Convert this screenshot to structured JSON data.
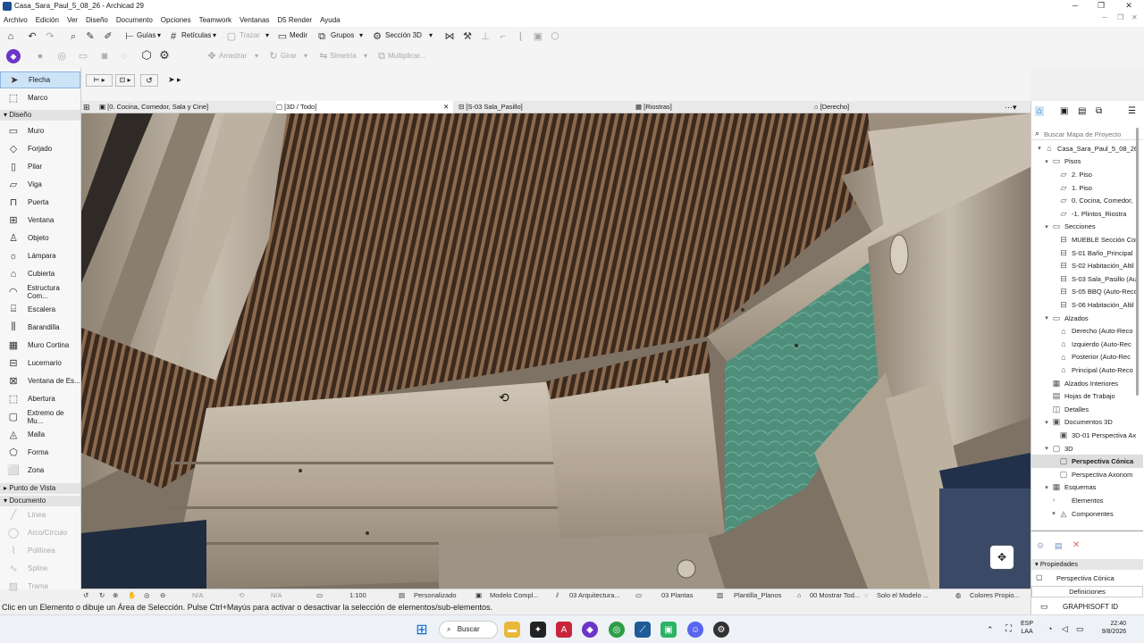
{
  "window": {
    "title": "Casa_Sara_Paul_5_08_26 - Archicad 29",
    "minimize": "─",
    "maximize": "❐",
    "close": "✕"
  },
  "menubar": [
    "Archivo",
    "Edición",
    "Ver",
    "Diseño",
    "Documento",
    "Opciones",
    "Teamwork",
    "Ventanas",
    "D5 Render",
    "Ayuda"
  ],
  "toolbar1": {
    "guias": "Guías",
    "reticulas": "Retículas",
    "trazar": "Trazar",
    "medir": "Medir",
    "grupos": "Grupos",
    "seccion3d": "Sección 3D"
  },
  "toolbar2": {
    "arrastrar": "Arrastrar",
    "girar": "Girar",
    "simetria": "Simetría",
    "multiplicar": "Multiplicar..."
  },
  "toolbox": {
    "select": [
      {
        "label": "Flecha",
        "icon": "arrow-icon"
      },
      {
        "label": "Marco",
        "icon": "marquee-icon"
      }
    ],
    "diseno_header": "Diseño",
    "diseno": [
      {
        "label": "Muro",
        "icon": "wall-icon"
      },
      {
        "label": "Forjado",
        "icon": "slab-icon"
      },
      {
        "label": "Pilar",
        "icon": "column-icon"
      },
      {
        "label": "Viga",
        "icon": "beam-icon"
      },
      {
        "label": "Puerta",
        "icon": "door-icon"
      },
      {
        "label": "Ventana",
        "icon": "window-icon"
      },
      {
        "label": "Objeto",
        "icon": "object-icon"
      },
      {
        "label": "Lámpara",
        "icon": "lamp-icon"
      },
      {
        "label": "Cubierta",
        "icon": "roof-icon"
      },
      {
        "label": "Estructura Com...",
        "icon": "shell-icon"
      },
      {
        "label": "Escalera",
        "icon": "stair-icon"
      },
      {
        "label": "Barandilla",
        "icon": "railing-icon"
      },
      {
        "label": "Muro Cortina",
        "icon": "curtain-wall-icon"
      },
      {
        "label": "Lucernario",
        "icon": "skylight-icon"
      },
      {
        "label": "Ventana de Es...",
        "icon": "corner-window-icon"
      },
      {
        "label": "Abertura",
        "icon": "opening-icon"
      },
      {
        "label": "Extremo de Mu...",
        "icon": "wall-end-icon"
      },
      {
        "label": "Malla",
        "icon": "mesh-icon"
      },
      {
        "label": "Forma",
        "icon": "morph-icon"
      },
      {
        "label": "Zona",
        "icon": "zone-icon"
      }
    ],
    "punto_header": "Punto de Vista",
    "documento_header": "Documento",
    "documento": [
      {
        "label": "Línea",
        "icon": "line-icon"
      },
      {
        "label": "Arco/Círculo",
        "icon": "arc-icon"
      },
      {
        "label": "Polilínea",
        "icon": "polyline-icon"
      },
      {
        "label": "Spline",
        "icon": "spline-icon"
      },
      {
        "label": "Trama",
        "icon": "fill-icon"
      }
    ]
  },
  "tabs": [
    {
      "label": "[0. Cocina, Comedor, Sala y Cine]",
      "icon": "floorplan-icon"
    },
    {
      "label": "[3D / Todo]",
      "icon": "3d-icon"
    },
    {
      "label": "[S-03 Sala_Pasillo]",
      "icon": "section-icon"
    },
    {
      "label": "[Riostras]",
      "icon": "schedule-icon"
    },
    {
      "label": "[Derecho]",
      "icon": "elevation-icon"
    }
  ],
  "status": {
    "zoom": "N/A",
    "angle": "N/A",
    "scale": "1:100",
    "layer": "Personalizado",
    "model": "Modelo Compl...",
    "arch": "03 Arquitectura...",
    "plantas": "03 Plantas",
    "planilla": "Plantilla_Planos",
    "mostrar": "00 Mostrar Tod...",
    "solo": "Solo el Modelo ...",
    "colores": "Colores Propio..."
  },
  "message": "Clic en un Elemento o dibuje un Área de Selección. Pulse Ctrl+Mayús para activar o desactivar la selección de elementos/sub-elementos.",
  "navigator": {
    "search_placeholder": "Buscar Mapa de Proyecto",
    "items": [
      {
        "label": "Casa_Sara_Paul_5_08_26",
        "level": 0,
        "arrow": "▾",
        "icon": "project-icon"
      },
      {
        "label": "Pisos",
        "level": 1,
        "arrow": "▾",
        "icon": "folder-icon"
      },
      {
        "label": "2. Piso",
        "level": 2,
        "arrow": "",
        "icon": "story-icon"
      },
      {
        "label": "1. Piso",
        "level": 2,
        "arrow": "",
        "icon": "story-icon"
      },
      {
        "label": "0. Cocina, Comedor,",
        "level": 2,
        "arrow": "",
        "icon": "story-icon"
      },
      {
        "label": "-1. Plintos_Riostra",
        "level": 2,
        "arrow": "",
        "icon": "story-icon"
      },
      {
        "label": "Secciones",
        "level": 1,
        "arrow": "▾",
        "icon": "folder-icon"
      },
      {
        "label": "MUEBLE Sección Cor",
        "level": 2,
        "arrow": "",
        "icon": "section-icon"
      },
      {
        "label": "S-01 Baño_Principal",
        "level": 2,
        "arrow": "",
        "icon": "section-icon"
      },
      {
        "label": "S-02 Habitación_Altil",
        "level": 2,
        "arrow": "",
        "icon": "section-icon"
      },
      {
        "label": "S-03 Sala_Pasillo (Au",
        "level": 2,
        "arrow": "",
        "icon": "section-icon"
      },
      {
        "label": "S-05 BBQ (Auto-Recc",
        "level": 2,
        "arrow": "",
        "icon": "section-icon"
      },
      {
        "label": "S-06 Habitación_Altil",
        "level": 2,
        "arrow": "",
        "icon": "section-icon"
      },
      {
        "label": "Alzados",
        "level": 1,
        "arrow": "▾",
        "icon": "folder-icon"
      },
      {
        "label": "Derecho (Auto-Reco",
        "level": 2,
        "arrow": "",
        "icon": "elevation-icon"
      },
      {
        "label": "Izquierdo (Auto-Rec",
        "level": 2,
        "arrow": "",
        "icon": "elevation-icon"
      },
      {
        "label": "Posterior (Auto-Rec",
        "level": 2,
        "arrow": "",
        "icon": "elevation-icon"
      },
      {
        "label": "Principal (Auto-Reco",
        "level": 2,
        "arrow": "",
        "icon": "elevation-icon"
      },
      {
        "label": "Alzados Interiores",
        "level": 1,
        "arrow": "",
        "icon": "interior-elevation-icon"
      },
      {
        "label": "Hojas de Trabajo",
        "level": 1,
        "arrow": "",
        "icon": "worksheet-icon"
      },
      {
        "label": "Detalles",
        "level": 1,
        "arrow": "",
        "icon": "detail-icon"
      },
      {
        "label": "Documentos 3D",
        "level": 1,
        "arrow": "▾",
        "icon": "3d-document-icon"
      },
      {
        "label": "3D-01 Perspectiva Ax",
        "level": 2,
        "arrow": "",
        "icon": "3d-document-icon"
      },
      {
        "label": "3D",
        "level": 1,
        "arrow": "▾",
        "icon": "3d-icon"
      },
      {
        "label": "Perspectiva Cónica",
        "level": 2,
        "arrow": "",
        "icon": "3d-icon",
        "selected": true
      },
      {
        "label": "Perspectiva Axonom",
        "level": 2,
        "arrow": "",
        "icon": "3d-icon"
      },
      {
        "label": "Esquemas",
        "level": 1,
        "arrow": "▾",
        "icon": "schedule-icon"
      },
      {
        "label": "Elementos",
        "level": 2,
        "arrow": "›",
        "icon": ""
      },
      {
        "label": "Componentes",
        "level": 2,
        "arrow": "▾",
        "icon": "component-icon"
      }
    ],
    "properties_header": "Propiedades",
    "properties_value": "Perspectiva Cónica",
    "definitions_button": "Definiciones",
    "graphisoft_id": "GRAPHISOFT ID"
  },
  "taskbar": {
    "search_label": "Buscar",
    "lang_top": "ESP",
    "lang_bottom": "LAA",
    "time": "22:40",
    "date": "9/8/2026"
  },
  "colors": {
    "accent": "#0a6cd6",
    "selection": "#cde3f7",
    "wood": "#b6aa9a",
    "ceiling": "#4a3324",
    "glass": "#4e8f7c"
  }
}
